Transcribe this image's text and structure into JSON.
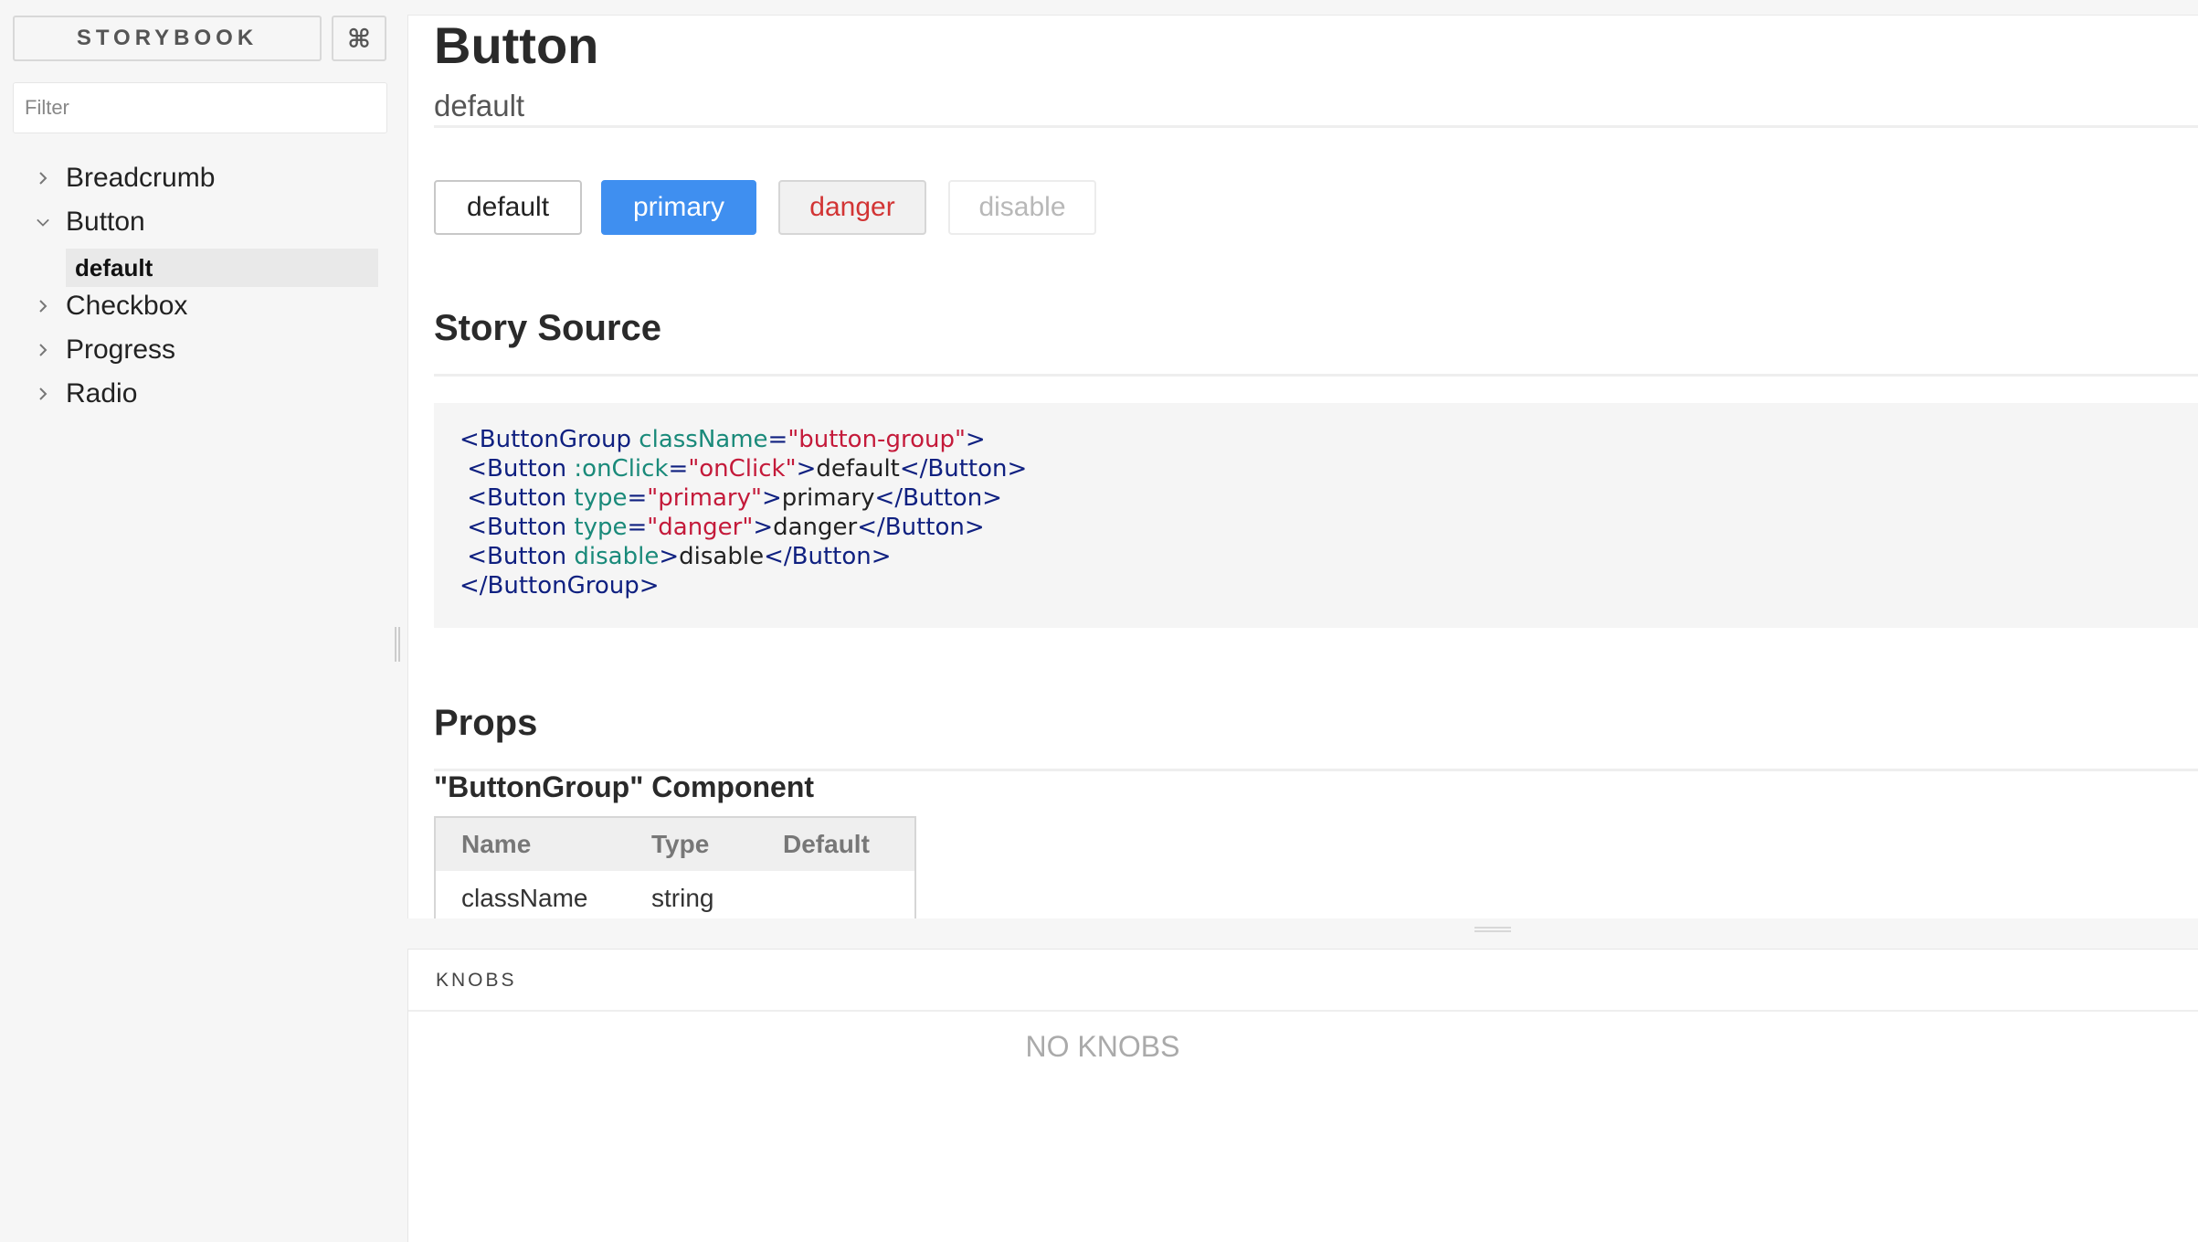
{
  "sidebar": {
    "brand_label": "STORYBOOK",
    "shortcut_label": "⌘",
    "filter_placeholder": "Filter",
    "tree": [
      {
        "label": "Breadcrumb",
        "expanded": false
      },
      {
        "label": "Button",
        "expanded": true
      },
      {
        "label": "Checkbox",
        "expanded": false
      },
      {
        "label": "Progress",
        "expanded": false
      },
      {
        "label": "Radio",
        "expanded": false
      }
    ],
    "selected_story": "default"
  },
  "preview": {
    "title": "Button",
    "subtitle": "default",
    "buttons": {
      "default": "default",
      "primary": "primary",
      "danger": "danger",
      "disable": "disable"
    },
    "story_source_title": "Story Source",
    "code": {
      "line1": {
        "open": "<ButtonGroup",
        "attr": " className",
        "eq": "=",
        "str": "\"button-group\"",
        "close": ">"
      },
      "line2": {
        "open": " <Button",
        "attr": " :onClick",
        "eq": "=",
        "str": "\"onClick\"",
        "close": ">",
        "text": "default",
        "end": "</Button>"
      },
      "line3": {
        "open": " <Button",
        "attr": " type",
        "eq": "=",
        "str": "\"primary\"",
        "close": ">",
        "text": "primary",
        "end": "</Button>"
      },
      "line4": {
        "open": " <Button",
        "attr": " type",
        "eq": "=",
        "str": "\"danger\"",
        "close": ">",
        "text": "danger",
        "end": "</Button>"
      },
      "line5": {
        "open": " <Button",
        "attr": " disable",
        "close": ">",
        "text": "disable",
        "end": "</Button>"
      },
      "line6": {
        "end": "</ButtonGroup>"
      }
    },
    "props_title": "Props",
    "component_title": "\"ButtonGroup\" Component",
    "props_table": {
      "headers": {
        "name": "Name",
        "type": "Type",
        "default": "Default"
      },
      "rows": [
        {
          "name": "className",
          "type": "string",
          "default": ""
        }
      ]
    }
  },
  "addons": {
    "tab_label": "KNOBS",
    "empty_text": "NO KNOBS"
  },
  "colors": {
    "primary": "#3f8ff0",
    "danger": "#d23434",
    "code_tag": "#0f2080",
    "code_attr": "#1a8a7a",
    "code_string": "#c41a3a"
  }
}
